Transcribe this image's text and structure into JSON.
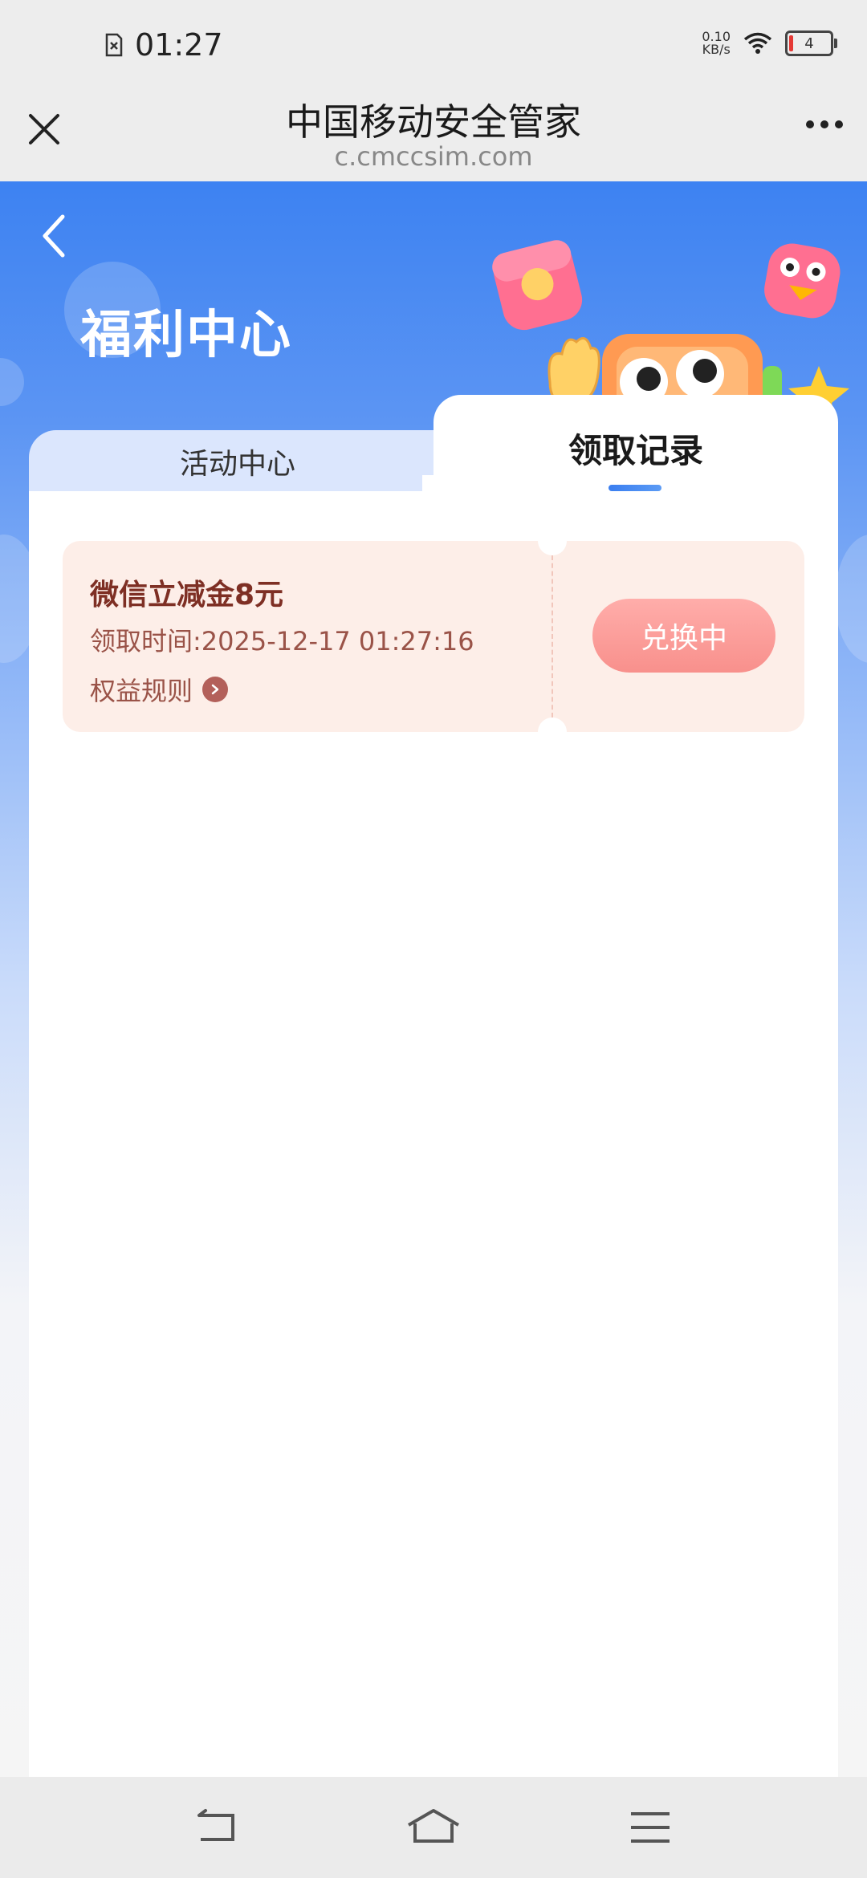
{
  "status_bar": {
    "time": "01:27",
    "net_speed_value": "0.10",
    "net_speed_unit": "KB/s",
    "battery_level": "4"
  },
  "title_bar": {
    "title": "中国移动安全管家",
    "url": "c.cmccsim.com"
  },
  "page": {
    "title": "福利中心"
  },
  "tabs": [
    {
      "label": "活动中心",
      "active": false
    },
    {
      "label": "领取记录",
      "active": true
    }
  ],
  "records": [
    {
      "title": "微信立减金8元",
      "time": "领取时间:2025-12-17 01:27:16",
      "rule_label": "权益规则",
      "status_button": "兑换中"
    }
  ],
  "icons": {
    "close": "close-icon",
    "more": "more-icon",
    "back": "back-arrow-icon",
    "rule_arrow": "chevron-right-icon",
    "nav_back": "nav-back-icon",
    "nav_home": "nav-home-icon",
    "nav_menu": "nav-menu-icon"
  },
  "colors": {
    "header_blue": "#3d82f2",
    "card_bg": "#fdeee8",
    "card_title": "#7e2f24",
    "button_pink": "#f8908c",
    "tab_underline": "#3a7ef0"
  }
}
